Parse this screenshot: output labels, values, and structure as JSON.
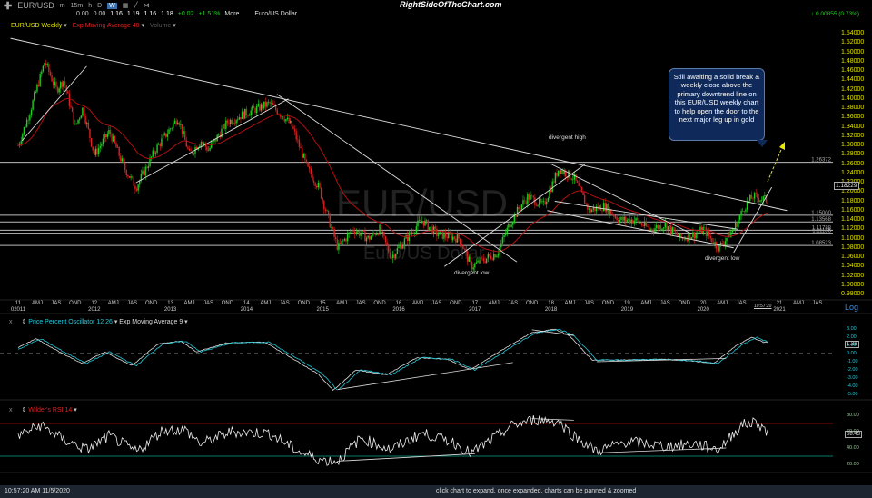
{
  "toolbar": {
    "symbol": "EUR/USD",
    "intervals": [
      "m",
      "15m",
      "h",
      "D",
      "W"
    ],
    "brand": "RightSideOfTheChart.com",
    "change_right": "0.00855 (0.73%)"
  },
  "quote": {
    "o": "0.00",
    "h": "0.00",
    "v1": "1.16",
    "v2": "1.19",
    "v3": "1.16",
    "v4": "1.18",
    "chg": "+0.02",
    "pct": "+1.51%",
    "more": "More",
    "name": "Euro/US Dollar"
  },
  "main_legend": {
    "series": "EUR/USD Weekly",
    "ema": "Exp Moving Average 40",
    "volume": "Volume"
  },
  "ppo_legend": {
    "name": "Price Percent Oscillator 12 26",
    "ema": "Exp Moving Average 9"
  },
  "rsi_legend": {
    "name": "Wilder's RSI 14"
  },
  "callout": "Still awaiting a solid break & weekly close above the primary downtrend line on this EUR/USD weekly chart to help open the door to the next major leg up in gold",
  "watermark": {
    "symbol": "EUR/USD",
    "name": "Euro/US Dollar"
  },
  "annotations": {
    "div_high": "divergent high",
    "div_low1": "divergent low",
    "div_low2": "divergent low"
  },
  "time_label": "10:57:20",
  "scale_mode": "Log",
  "status": {
    "left": "10:57:20 AM 11/5/2020",
    "center": "click chart to expand. once expanded, charts can be panned & zoomed"
  },
  "colors": {
    "up": "#1fd11f",
    "down": "#e02020",
    "ema": "#b01010",
    "ppo": "#22c8d8",
    "axis": "#e0e000"
  },
  "chart_data": {
    "type": "line",
    "title": "EUR/USD Weekly",
    "x_ticks": [
      {
        "v": 2011,
        "l": "11",
        "y": "02011"
      },
      {
        "v": 2011.25,
        "l": "AMJ"
      },
      {
        "v": 2011.5,
        "l": "JAS"
      },
      {
        "v": 2011.75,
        "l": "OND"
      },
      {
        "v": 2012,
        "l": "12",
        "y": "2012"
      },
      {
        "v": 2012.25,
        "l": "AMJ"
      },
      {
        "v": 2012.5,
        "l": "JAS"
      },
      {
        "v": 2012.75,
        "l": "OND"
      },
      {
        "v": 2013,
        "l": "13",
        "y": "2013"
      },
      {
        "v": 2013.25,
        "l": "AMJ"
      },
      {
        "v": 2013.5,
        "l": "JAS"
      },
      {
        "v": 2013.75,
        "l": "OND"
      },
      {
        "v": 2014,
        "l": "14",
        "y": "2014"
      },
      {
        "v": 2014.25,
        "l": "AMJ"
      },
      {
        "v": 2014.5,
        "l": "JAS"
      },
      {
        "v": 2014.75,
        "l": "OND"
      },
      {
        "v": 2015,
        "l": "15",
        "y": "2015"
      },
      {
        "v": 2015.25,
        "l": "AMJ"
      },
      {
        "v": 2015.5,
        "l": "JAS"
      },
      {
        "v": 2015.75,
        "l": "OND"
      },
      {
        "v": 2016,
        "l": "16",
        "y": "2016"
      },
      {
        "v": 2016.25,
        "l": "AMJ"
      },
      {
        "v": 2016.5,
        "l": "JAS"
      },
      {
        "v": 2016.75,
        "l": "OND"
      },
      {
        "v": 2017,
        "l": "17",
        "y": "2017"
      },
      {
        "v": 2017.25,
        "l": "AMJ"
      },
      {
        "v": 2017.5,
        "l": "JAS"
      },
      {
        "v": 2017.75,
        "l": "OND"
      },
      {
        "v": 2018,
        "l": "18",
        "y": "2018"
      },
      {
        "v": 2018.25,
        "l": "AMJ"
      },
      {
        "v": 2018.5,
        "l": "JAS"
      },
      {
        "v": 2018.75,
        "l": "OND"
      },
      {
        "v": 2019,
        "l": "19",
        "y": "2019"
      },
      {
        "v": 2019.25,
        "l": "AMJ"
      },
      {
        "v": 2019.5,
        "l": "JAS"
      },
      {
        "v": 2019.75,
        "l": "OND"
      },
      {
        "v": 2020,
        "l": "20",
        "y": "2020"
      },
      {
        "v": 2020.25,
        "l": "AMJ"
      },
      {
        "v": 2020.5,
        "l": "JAS"
      },
      {
        "v": 2021,
        "l": "21",
        "y": "2021"
      },
      {
        "v": 2021.25,
        "l": "AMJ"
      },
      {
        "v": 2021.5,
        "l": "JAS"
      }
    ],
    "y_ticks": [
      "1.54000",
      "1.52000",
      "1.50000",
      "1.48000",
      "1.46000",
      "1.44000",
      "1.42000",
      "1.40000",
      "1.38000",
      "1.36000",
      "1.34000",
      "1.32000",
      "1.30000",
      "1.28000",
      "1.26000",
      "1.24000",
      "1.22000",
      "1.20000",
      "1.18000",
      "1.16000",
      "1.14000",
      "1.12000",
      "1.10000",
      "1.08000",
      "1.06000",
      "1.04000",
      "1.02000",
      "1.00000",
      "0.98000"
    ],
    "ylim": [
      0.98,
      1.54
    ],
    "last_price": "1.18229",
    "levels": [
      {
        "v": 1.26372,
        "l": "1.26372"
      },
      {
        "v": 1.15,
        "l": "1.15000"
      },
      {
        "v": 1.13568,
        "l": "1.13568"
      },
      {
        "v": 1.11788,
        "l": "1.11788"
      },
      {
        "v": 1.11136,
        "l": "1.11136"
      },
      {
        "v": 1.08523,
        "l": "1.08523"
      }
    ],
    "price": [
      [
        2011.0,
        1.3
      ],
      [
        2011.15,
        1.37
      ],
      [
        2011.35,
        1.48
      ],
      [
        2011.5,
        1.42
      ],
      [
        2011.6,
        1.44
      ],
      [
        2011.75,
        1.34
      ],
      [
        2011.85,
        1.38
      ],
      [
        2012.0,
        1.28
      ],
      [
        2012.2,
        1.33
      ],
      [
        2012.4,
        1.25
      ],
      [
        2012.55,
        1.21
      ],
      [
        2012.8,
        1.29
      ],
      [
        2013.1,
        1.36
      ],
      [
        2013.25,
        1.28
      ],
      [
        2013.4,
        1.31
      ],
      [
        2013.5,
        1.29
      ],
      [
        2013.75,
        1.35
      ],
      [
        2014.0,
        1.37
      ],
      [
        2014.3,
        1.39
      ],
      [
        2014.5,
        1.36
      ],
      [
        2014.6,
        1.34
      ],
      [
        2014.8,
        1.25
      ],
      [
        2014.95,
        1.21
      ],
      [
        2015.1,
        1.13
      ],
      [
        2015.2,
        1.08
      ],
      [
        2015.4,
        1.12
      ],
      [
        2015.6,
        1.1
      ],
      [
        2015.75,
        1.12
      ],
      [
        2015.9,
        1.06
      ],
      [
        2016.3,
        1.14
      ],
      [
        2016.5,
        1.11
      ],
      [
        2016.8,
        1.1
      ],
      [
        2016.95,
        1.04
      ],
      [
        2017.3,
        1.07
      ],
      [
        2017.45,
        1.13
      ],
      [
        2017.6,
        1.17
      ],
      [
        2017.7,
        1.19
      ],
      [
        2017.9,
        1.17
      ],
      [
        2018.1,
        1.25
      ],
      [
        2018.3,
        1.23
      ],
      [
        2018.5,
        1.16
      ],
      [
        2018.7,
        1.17
      ],
      [
        2018.9,
        1.14
      ],
      [
        2019.1,
        1.14
      ],
      [
        2019.3,
        1.12
      ],
      [
        2019.5,
        1.13
      ],
      [
        2019.7,
        1.1
      ],
      [
        2019.9,
        1.11
      ],
      [
        2020.0,
        1.12
      ],
      [
        2020.2,
        1.08
      ],
      [
        2020.4,
        1.12
      ],
      [
        2020.55,
        1.17
      ],
      [
        2020.65,
        1.19
      ],
      [
        2020.85,
        1.18229
      ]
    ],
    "trendlines": [
      [
        2010.9,
        1.53,
        2021.1,
        1.16
      ],
      [
        2011.05,
        1.31,
        2011.9,
        1.47
      ],
      [
        2012.55,
        1.22,
        2014.55,
        1.4
      ],
      [
        2014.4,
        1.41,
        2017.55,
        1.05
      ],
      [
        2016.6,
        1.04,
        2018.45,
        1.26
      ],
      [
        2018.0,
        1.26,
        2019.85,
        1.11
      ],
      [
        2018.05,
        1.18,
        2020.45,
        1.12
      ],
      [
        2017.95,
        1.16,
        2020.4,
        1.08
      ],
      [
        2020.4,
        1.07,
        2020.9,
        1.21
      ]
    ],
    "ppo": {
      "ylim": [
        -5,
        3
      ],
      "ticks": [
        "3.00",
        "2.00",
        "1.00",
        "0.00",
        "-1.00",
        "-2.00",
        "-3.00",
        "-4.00",
        "-5.00"
      ],
      "last": "1.38",
      "points": [
        [
          2011.0,
          0.5
        ],
        [
          2011.3,
          1.8
        ],
        [
          2011.6,
          0.2
        ],
        [
          2011.9,
          -1.2
        ],
        [
          2012.2,
          0.2
        ],
        [
          2012.55,
          -1.5
        ],
        [
          2012.9,
          1.2
        ],
        [
          2013.2,
          1.5
        ],
        [
          2013.4,
          0.2
        ],
        [
          2013.8,
          1.3
        ],
        [
          2014.3,
          1.4
        ],
        [
          2014.7,
          -0.8
        ],
        [
          2015.0,
          -2.5
        ],
        [
          2015.2,
          -4.5
        ],
        [
          2015.5,
          -2.0
        ],
        [
          2015.9,
          -2.6
        ],
        [
          2016.3,
          -0.5
        ],
        [
          2016.7,
          -0.7
        ],
        [
          2017.0,
          -2.0
        ],
        [
          2017.5,
          0.9
        ],
        [
          2017.8,
          2.5
        ],
        [
          2018.1,
          3.0
        ],
        [
          2018.3,
          2.2
        ],
        [
          2018.6,
          -0.8
        ],
        [
          2019.0,
          -0.8
        ],
        [
          2019.5,
          -0.7
        ],
        [
          2019.9,
          -0.9
        ],
        [
          2020.2,
          -1.2
        ],
        [
          2020.5,
          1.0
        ],
        [
          2020.7,
          2.0
        ],
        [
          2020.85,
          1.38
        ]
      ]
    },
    "rsi": {
      "ylim": [
        20,
        80
      ],
      "ticks": [
        "80.00",
        "60.00",
        "40.00",
        "20.00"
      ],
      "last": "58.43",
      "points": [
        [
          2011.0,
          55
        ],
        [
          2011.3,
          68
        ],
        [
          2011.6,
          50
        ],
        [
          2011.9,
          38
        ],
        [
          2012.2,
          55
        ],
        [
          2012.55,
          35
        ],
        [
          2012.9,
          62
        ],
        [
          2013.2,
          62
        ],
        [
          2013.4,
          45
        ],
        [
          2013.8,
          60
        ],
        [
          2014.3,
          58
        ],
        [
          2014.7,
          35
        ],
        [
          2015.0,
          25
        ],
        [
          2015.2,
          24
        ],
        [
          2015.5,
          52
        ],
        [
          2015.9,
          38
        ],
        [
          2016.3,
          58
        ],
        [
          2016.7,
          48
        ],
        [
          2016.95,
          33
        ],
        [
          2017.5,
          68
        ],
        [
          2017.8,
          75
        ],
        [
          2018.1,
          72
        ],
        [
          2018.3,
          55
        ],
        [
          2018.6,
          36
        ],
        [
          2019.0,
          48
        ],
        [
          2019.5,
          42
        ],
        [
          2019.9,
          45
        ],
        [
          2020.2,
          38
        ],
        [
          2020.5,
          68
        ],
        [
          2020.7,
          72
        ],
        [
          2020.85,
          58.43
        ]
      ]
    }
  }
}
